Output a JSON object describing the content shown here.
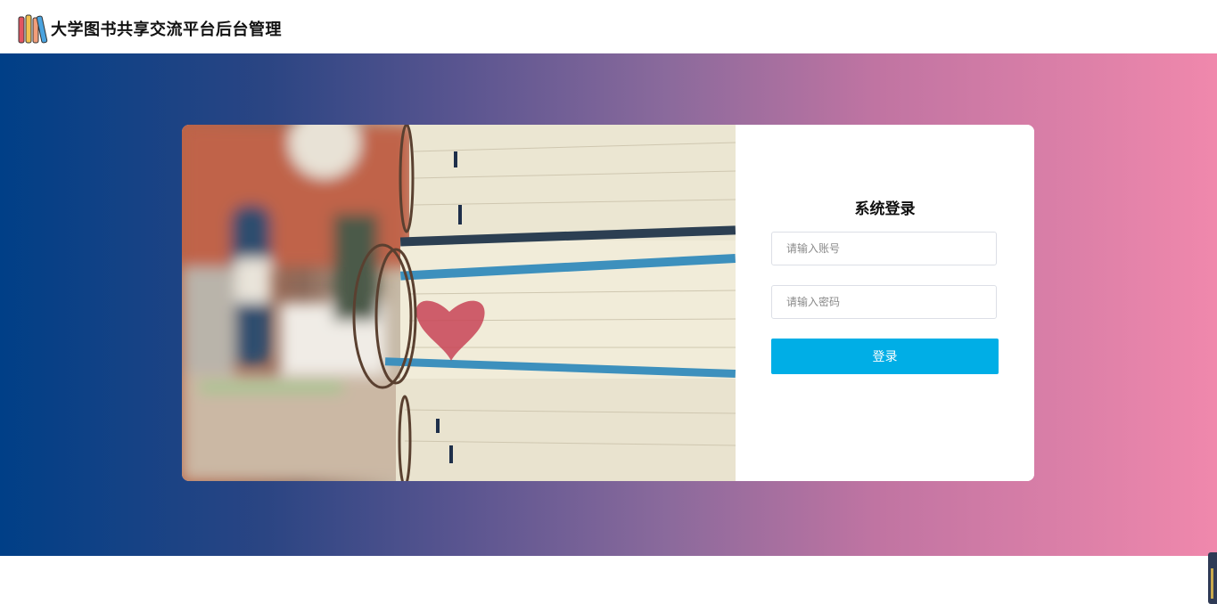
{
  "header": {
    "title": "大学图书共享交流平台后台管理",
    "logo_icon": "books-icon"
  },
  "login": {
    "title": "系统登录",
    "username_placeholder": "请输入账号",
    "password_placeholder": "请输入密码",
    "username_value": "",
    "password_value": "",
    "submit_label": "登录"
  },
  "colors": {
    "gradient_start": "#003f87",
    "gradient_end": "#f088ac",
    "button": "#00aee6"
  },
  "illustration": "stacked-notebooks-photo"
}
